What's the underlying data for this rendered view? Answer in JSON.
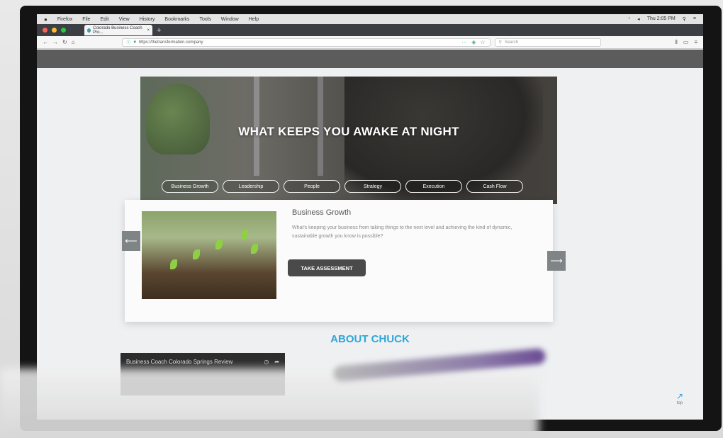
{
  "menubar": {
    "apple": "",
    "items": [
      "Firefox",
      "File",
      "Edit",
      "View",
      "History",
      "Bookmarks",
      "Tools",
      "Window",
      "Help"
    ],
    "clock": "Thu 2:05 PM"
  },
  "browser": {
    "tab_title": "Colorado Business Coach Pro...",
    "tab_close": "×",
    "new_tab": "+",
    "url": "https://thetransformation.company",
    "search_placeholder": "Search",
    "nav_back": "←",
    "nav_forward": "→",
    "nav_reload": "↻",
    "nav_home": "⌂"
  },
  "hero": {
    "title": "WHAT KEEPS YOU AWAKE AT NIGHT",
    "pills": [
      "Business Growth",
      "Leadership",
      "People",
      "Strategy",
      "Execution",
      "Cash Flow"
    ]
  },
  "card": {
    "title": "Business Growth",
    "description": "What's keeping your business from taking things to the next level and achieving the kind of dynamic, sustainable growth you know is possible?",
    "button": "TAKE ASSESSMENT",
    "prev": "⟵",
    "next": "⟶"
  },
  "about": {
    "title": "ABOUT CHUCK"
  },
  "video": {
    "title": "Business Coach Colorado Springs Review"
  },
  "totop": {
    "label": "top"
  },
  "colors": {
    "accent": "#2fa6d9",
    "button": "#4a4a4a"
  }
}
